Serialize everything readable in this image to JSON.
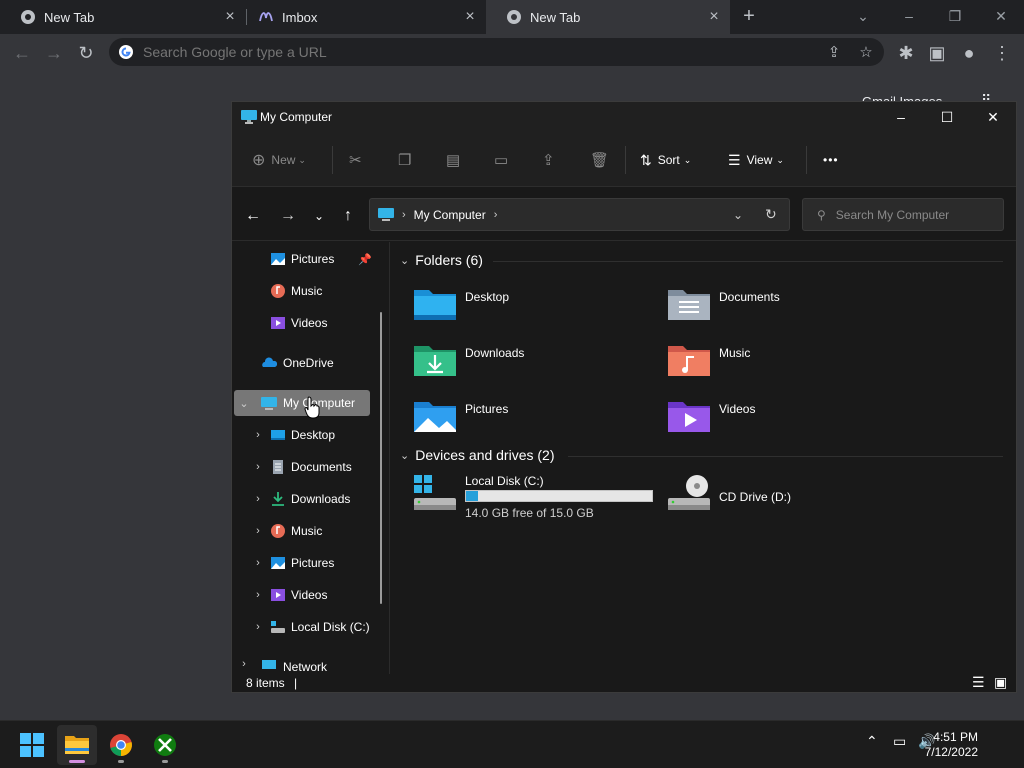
{
  "browser": {
    "tabs": [
      {
        "title": "New Tab",
        "active": false
      },
      {
        "title": "Imbox",
        "active": false
      },
      {
        "title": "New Tab",
        "active": true
      }
    ],
    "omnibox_placeholder": "Search Google or type a URL",
    "ntp_links": "Gmail   Images"
  },
  "explorer": {
    "title": "My Computer",
    "command_bar": {
      "new_label": "New",
      "sort_label": "Sort",
      "view_label": "View",
      "more_label": "•••"
    },
    "address": {
      "location": "My Computer",
      "search_placeholder": "Search My Computer"
    },
    "nav_pane": {
      "items": [
        {
          "label": "Pictures",
          "icon": "pictures-icon",
          "pinned": true
        },
        {
          "label": "Music",
          "icon": "music-icon"
        },
        {
          "label": "Videos",
          "icon": "videos-icon"
        },
        {
          "label": "OneDrive",
          "icon": "onedrive-icon"
        },
        {
          "label": "My Computer",
          "icon": "computer-icon",
          "selected": true
        },
        {
          "label": "Desktop",
          "icon": "desktop-icon"
        },
        {
          "label": "Documents",
          "icon": "documents-icon"
        },
        {
          "label": "Downloads",
          "icon": "downloads-icon"
        },
        {
          "label": "Music",
          "icon": "music-icon"
        },
        {
          "label": "Pictures",
          "icon": "pictures-icon"
        },
        {
          "label": "Videos",
          "icon": "videos-icon"
        },
        {
          "label": "Local Disk (C:)",
          "icon": "local-disk-icon"
        },
        {
          "label": "Network",
          "icon": "network-icon"
        }
      ]
    },
    "folders_header": "Folders (6)",
    "folders": [
      {
        "label": "Desktop"
      },
      {
        "label": "Documents"
      },
      {
        "label": "Downloads"
      },
      {
        "label": "Music"
      },
      {
        "label": "Pictures"
      },
      {
        "label": "Videos"
      }
    ],
    "drives_header": "Devices and drives (2)",
    "drives": [
      {
        "label": "Local Disk (C:)",
        "free_text": "14.0 GB free of 15.0 GB",
        "used_fraction": 0.067
      },
      {
        "label": "CD Drive (D:)"
      }
    ],
    "status": "8 items"
  },
  "taskbar": {
    "time": "4:51 PM",
    "date": "7/12/2022"
  },
  "colors": {
    "accent": "#26a0da",
    "explorer_bg": "#191919",
    "chrome_bg": "#35363a"
  }
}
